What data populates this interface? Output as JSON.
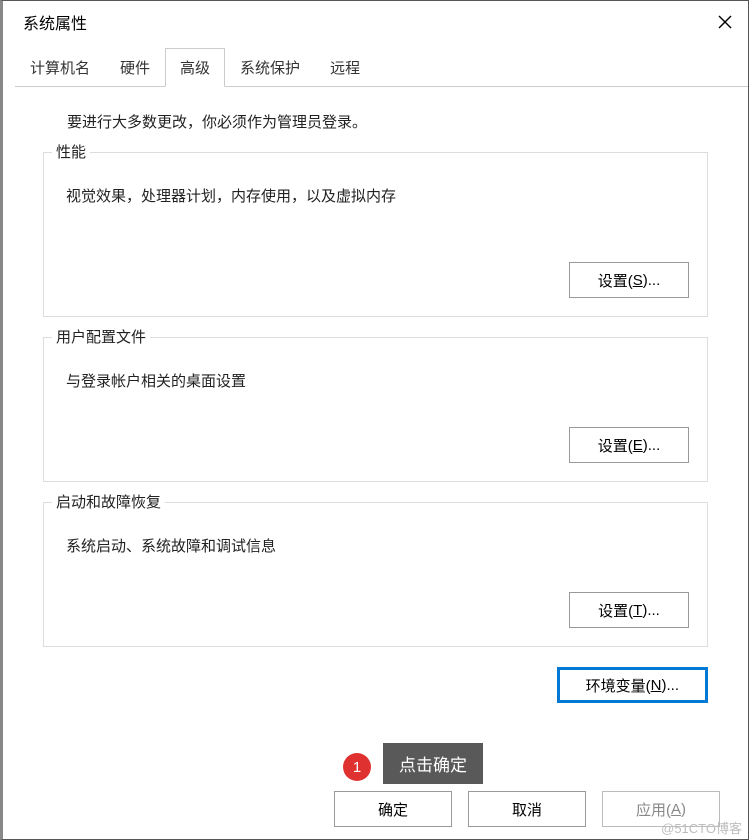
{
  "window": {
    "title": "系统属性"
  },
  "tabs": {
    "computer_name": "计算机名",
    "hardware": "硬件",
    "advanced": "高级",
    "system_protection": "系统保护",
    "remote": "远程"
  },
  "intro": "要进行大多数更改，你必须作为管理员登录。",
  "groups": {
    "performance": {
      "legend": "性能",
      "desc": "视觉效果，处理器计划，内存使用，以及虚拟内存",
      "btn_prefix": "设置(",
      "btn_mnemonic": "S",
      "btn_suffix": ")..."
    },
    "profiles": {
      "legend": "用户配置文件",
      "desc": "与登录帐户相关的桌面设置",
      "btn_prefix": "设置(",
      "btn_mnemonic": "E",
      "btn_suffix": ")..."
    },
    "startup": {
      "legend": "启动和故障恢复",
      "desc": "系统启动、系统故障和调试信息",
      "btn_prefix": "设置(",
      "btn_mnemonic": "T",
      "btn_suffix": ")..."
    }
  },
  "env": {
    "btn_prefix": "环境变量(",
    "btn_mnemonic": "N",
    "btn_suffix": ")..."
  },
  "footer": {
    "ok": "确定",
    "cancel": "取消",
    "apply_prefix": "应用(",
    "apply_mnemonic": "A",
    "apply_suffix": ")"
  },
  "annotation": {
    "step": "1",
    "text": "点击确定"
  },
  "watermark": "@51CTO博客"
}
